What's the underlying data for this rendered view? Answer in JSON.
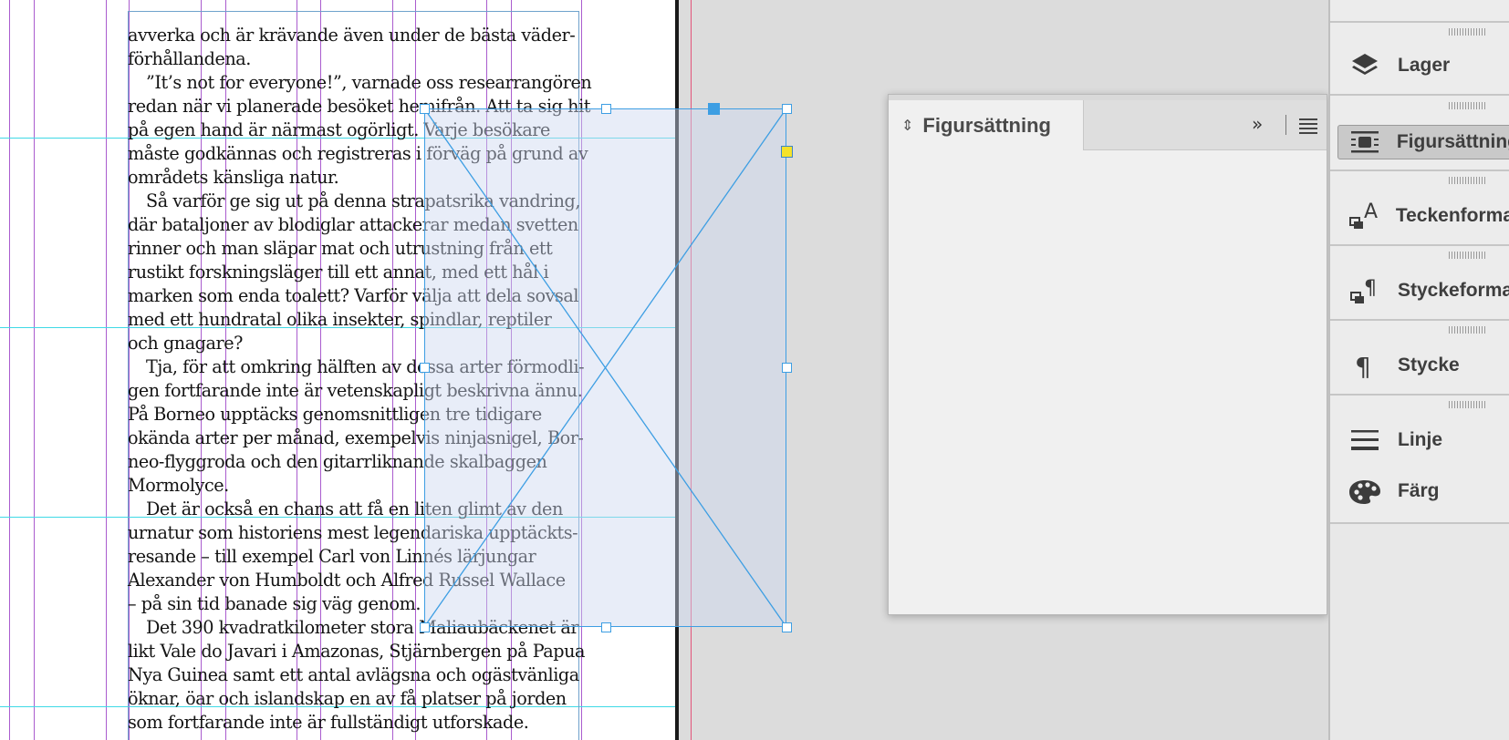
{
  "document": {
    "paragraphs": [
      [
        "avverka och är krävande även under de bästa väder-",
        "förhållandena."
      ],
      [
        "”It’s not for everyone!”, varnade oss researrangören",
        "redan när vi planerade besöket hemifrån. Att ta sig hit",
        "på egen hand är närmast ogörligt. Varje besökare",
        "måste godkännas och registreras i förväg på grund av",
        "områdets känsliga natur."
      ],
      [
        "Så varför ge sig ut på denna strapatsrika vandring,",
        "där bataljoner av blodiglar attackerar medan svetten",
        "rinner och man släpar mat och utrustning från ett",
        "rustikt forskningsläger till ett annat, med ett hål i",
        "marken som enda toalett? Varför välja att dela sovsal",
        "med ett hundratal olika insekter, spindlar, reptiler",
        "och gnagare?"
      ],
      [
        "Tja, för att omkring hälften av dessa arter förmodli-",
        "gen fortfarande inte är vetenskapligt beskrivna ännu.",
        "På Borneo upptäcks genomsnittligen tre tidigare",
        "okända arter per månad, exempelvis ninjasnigel, Bor-",
        "neo-flyggroda och den gitarrliknande skalbaggen",
        "Mormolyce."
      ],
      [
        "Det är också en chans att få en liten glimt av den",
        "urnatur som historiens mest legendariska upptäckts-",
        "resande – till exempel Carl von Linnés lärjungar",
        "Alexander von Humboldt och Alfred Russel Wallace",
        "– på sin tid banade sig väg genom."
      ],
      [
        "Det 390 kvadratkilometer stora Maliaubäckenet är",
        "likt Vale do Javari i Amazonas, Stjärnbergen på Papua",
        "Nya Guinea samt ett antal avlägsna och ogästvänliga",
        "öknar, öar och islandskap en av få platser på jorden",
        "som fortfarande inte är fullständigt utforskade."
      ]
    ]
  },
  "panel": {
    "tab_title": "Figursättning",
    "collapse_label": "»",
    "menu_icon": "hamburger-menu-icon"
  },
  "dock": {
    "items": [
      {
        "label": "Lager",
        "icon": "layers-icon"
      },
      {
        "label": "Figursättning",
        "icon": "text-wrap-icon"
      },
      {
        "label": "Teckenformat",
        "icon": "character-styles-icon"
      },
      {
        "label": "Styckeformat",
        "icon": "paragraph-styles-icon"
      },
      {
        "label": "Stycke",
        "icon": "paragraph-icon"
      },
      {
        "label": "Linje",
        "icon": "stroke-icon"
      },
      {
        "label": "Färg",
        "icon": "color-palette-icon"
      }
    ]
  },
  "colors": {
    "guide_purple": "#9b3fc6",
    "guide_cyan": "#3fd9e6",
    "selection_blue": "#3d9ee3",
    "bleed_red": "#e3547a",
    "anchor_yellow": "#f5e22a"
  }
}
